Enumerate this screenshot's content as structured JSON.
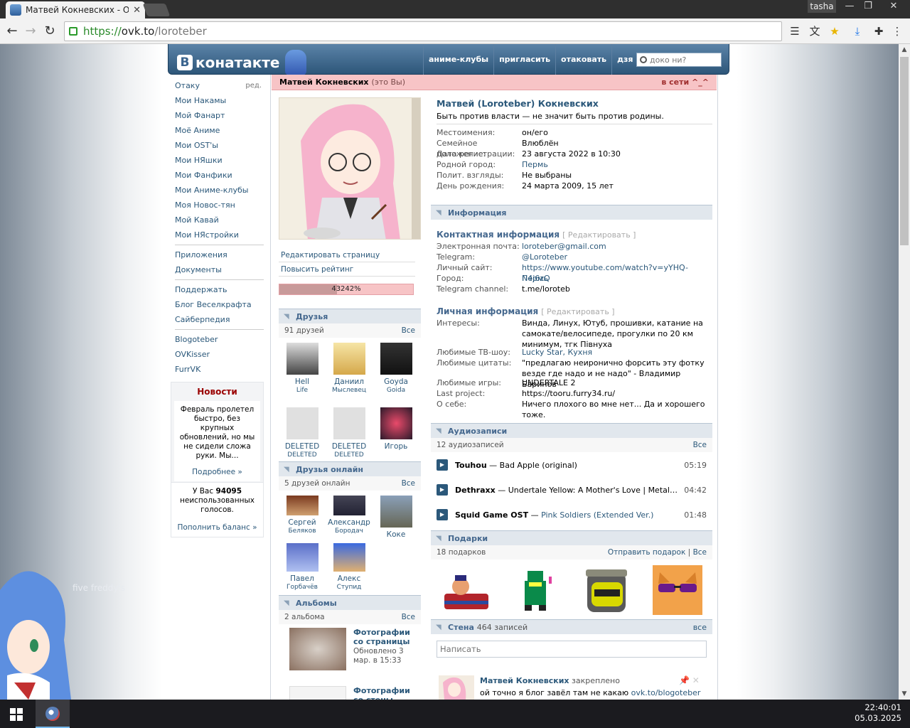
{
  "browser": {
    "tab_title": "Матвей Кокневских - Ope",
    "tab_close": "✕",
    "user": "tasha",
    "win_min": "—",
    "win_max": "❐",
    "win_close": "✕",
    "url_scheme": "https://",
    "url_host": "ovk.to",
    "url_path": "/loroteber",
    "icons": [
      "reader-icon",
      "translate-icon",
      "bookmark-star-icon",
      "download-icon",
      "extensions-icon",
      "menu-icon"
    ]
  },
  "header": {
    "logo_b": "В",
    "logo_text": "конатакте",
    "nav": [
      "аниме-клубы",
      "пригласить",
      "отаковать",
      "дзя нэ"
    ],
    "search_placeholder": "доко ни?"
  },
  "leftmenu": {
    "edit": "ред.",
    "group1": [
      "Отаку",
      "Мои Накамы",
      "Мой Фанарт",
      "Моё Аниме",
      "Мои OST'ы",
      "Мои НЯшки",
      "Мои Фанфики",
      "Мои Аниме-клубы",
      "Моя Новос-тян",
      "Мой Кавай",
      "Мои НЯстройки"
    ],
    "group2": [
      "Приложения",
      "Документы"
    ],
    "group3": [
      "Поддержать",
      "Блог Веселкрафта",
      "Сайберпедия"
    ],
    "group4": [
      "Blogoteber",
      "OVKisser",
      "FurrVK"
    ]
  },
  "news": {
    "title": "Новости",
    "body": "Февраль пролетел быстро, без крупных обновлений, но мы не сидели сложа руки. Мы...",
    "more": "Подробнее »"
  },
  "votes": {
    "prefix": "У Вас",
    "count": "94095",
    "suffix": "неиспользованных голосов.",
    "add": "Пополнить баланс »"
  },
  "profile": {
    "name": "Матвей Кокневских",
    "you": "(это Вы)",
    "online": "в сети ^_^",
    "fullname": "Матвей (Loroteber) Кокневских",
    "status": "Быть против власти — не значит быть против родины.",
    "edit_page": "Редактировать страницу",
    "boost_rating": "Повысить рейтинг",
    "rating_text": "43242%",
    "rating_fill": 0.43,
    "basic": [
      {
        "k": "Местоимения:",
        "v": "он/его"
      },
      {
        "k": "Семейное положение:",
        "v": "Влюблён"
      },
      {
        "k": "Дата регистрации:",
        "v": "23 августа 2022 в 10:30"
      },
      {
        "k": "Родной город:",
        "v": "Пермь"
      },
      {
        "k": "Полит. взгляды:",
        "v": "Не выбраны"
      },
      {
        "k": "День рождения:",
        "v": "24 марта 2009, 15 лет"
      }
    ]
  },
  "info": {
    "section": "Информация",
    "contact_title": "Контактная информация",
    "edit": "[ Редактировать ]",
    "contact": [
      {
        "k": "Электронная почта:",
        "v": "loroteber@gmail.com"
      },
      {
        "k": "Telegram:",
        "v": "@Loroteber"
      },
      {
        "k": "Личный сайт:",
        "v": "https://www.youtube.com/watch?v=yYHQ-N4j6zQ"
      },
      {
        "k": "Город:",
        "v": "Пермь"
      },
      {
        "k": "Telegram channel:",
        "v": "t.me/loroteb"
      }
    ],
    "personal_title": "Личная информация",
    "personal": [
      {
        "k": "Интересы:",
        "v": "Винда, Линух, Ютуб, прошивки, катание на самокате/велосипеде, прогулки по 20 км минимум, тгк Півнуха"
      },
      {
        "k": "Любимые ТВ-шоу:",
        "v": "Lucky Star, Кухня"
      },
      {
        "k": "Любимые цитаты:",
        "v": "\"предлагаю неиронично форсить эту фотку везде где надо и не надо\" - Владимир Баринов"
      },
      {
        "k": "Любимые игры:",
        "v": "UNDERTALE 2"
      },
      {
        "k": "Last project:",
        "v": "https://tooru.furry34.ru/"
      },
      {
        "k": "О себе:",
        "v": "Ничего плохого во мне нет... Да и хорошего тоже."
      }
    ]
  },
  "friends": {
    "title": "Друзья",
    "count": "91 друзей",
    "all": "Все",
    "items": [
      {
        "fn": "Hell",
        "ln": "Life"
      },
      {
        "fn": "Даниил",
        "ln": "Мыслевец"
      },
      {
        "fn": "Goyda",
        "ln": "Goida"
      },
      {
        "fn": "DELETED",
        "ln": "DELETED"
      },
      {
        "fn": "DELETED",
        "ln": "DELETED"
      },
      {
        "fn": "Игорь",
        "ln": ""
      }
    ]
  },
  "friends_online": {
    "title": "Друзья онлайн",
    "count": "5 друзей онлайн",
    "all": "Все",
    "items": [
      {
        "fn": "Сергей",
        "ln": "Беляков"
      },
      {
        "fn": "Александр",
        "ln": "Бородач"
      },
      {
        "fn": "Коке",
        "ln": ""
      },
      {
        "fn": "Павел",
        "ln": "Горбачёв"
      },
      {
        "fn": "Алекс",
        "ln": "Ступид"
      }
    ]
  },
  "albums": {
    "title": "Альбомы",
    "count": "2 альбома",
    "all": "Все",
    "items": [
      {
        "t": "Фотографии со страницы",
        "d": "Обновлено 3 мар. в 15:33"
      },
      {
        "t": "Фотографии со стены",
        "d": ""
      }
    ]
  },
  "audio": {
    "title": "Аудиозаписи",
    "count": "12 аудиозаписей",
    "all": "Все",
    "tracks": [
      {
        "artist": "Touhou",
        "title": "Bad Apple (original)",
        "dur": "05:19"
      },
      {
        "artist": "Dethraxx",
        "title": "Undertale Yellow: A Mother's Love | Metal Guitar...",
        "dur": "04:42"
      },
      {
        "artist": "Squid Game OST",
        "title": "Pink Soldiers (Extended Ver.)",
        "dur": "01:48"
      }
    ]
  },
  "gifts": {
    "title": "Подарки",
    "count": "18 подарков",
    "send": "Отправить подарок",
    "sep": "|",
    "all": "Все"
  },
  "wall": {
    "title": "Стена",
    "count": "464 записей",
    "all": "все",
    "placeholder": "Написать",
    "post_author": "Матвей Кокневских",
    "post_pinned": "закреплено",
    "post_text": "ой точно я блог завёл там не какаю",
    "post_link": "ovk.to/blogoteber"
  },
  "desktop": {
    "deco_text": "five freddy's"
  },
  "taskbar": {
    "time": "22:40:01",
    "date": "05.03.2025"
  },
  "colors": {
    "accent": "#2b587a",
    "profile_bar": "#f7c4c6",
    "header": "#2d5679"
  }
}
